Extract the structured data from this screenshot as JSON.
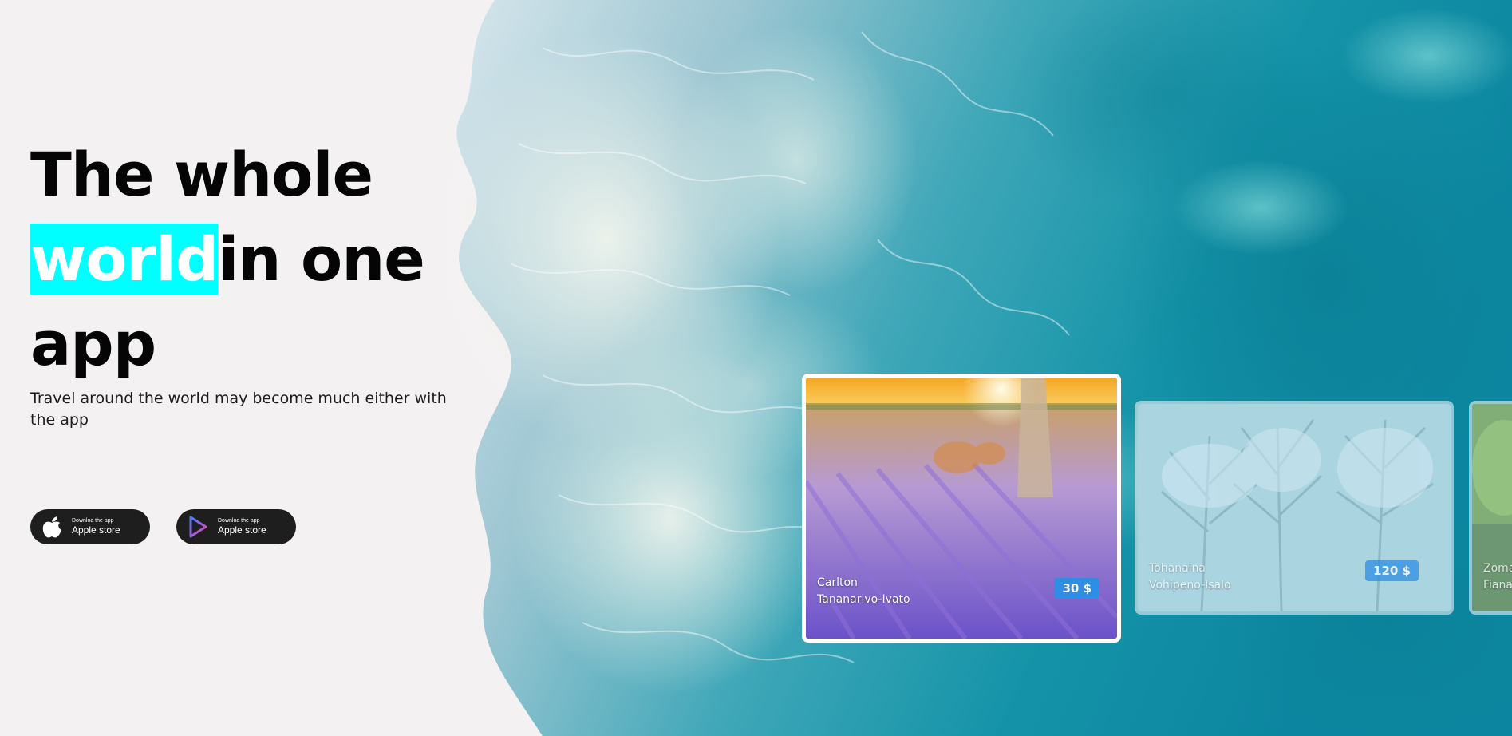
{
  "hero": {
    "title_line1": "The whole",
    "title_highlight": "world",
    "title_line2_rest": "in one",
    "title_line3": "app",
    "subtitle": "Travel around the world may become much either with the app"
  },
  "stores": [
    {
      "small": "Downloa the app",
      "big": "Apple store",
      "icon": "apple-icon"
    },
    {
      "small": "Downloa the app",
      "big": "Apple store",
      "icon": "play-icon"
    }
  ],
  "cards": [
    {
      "name": "Carlton",
      "location": "Tananarivo-Ivato",
      "price": "30 $",
      "scene": "lavender-field"
    },
    {
      "name": "Tohanaina",
      "location": "Vohipeno-Isalo",
      "price": "120 $",
      "scene": "frosted-trees"
    },
    {
      "name": "Zoma",
      "location": "Fiana",
      "price": "",
      "scene": "green-forest"
    }
  ],
  "colors": {
    "highlight": "#00ffff",
    "price_badge": "#2d8ee4",
    "store_button": "#1e1e1e",
    "page_bg": "#f4f1f2"
  }
}
